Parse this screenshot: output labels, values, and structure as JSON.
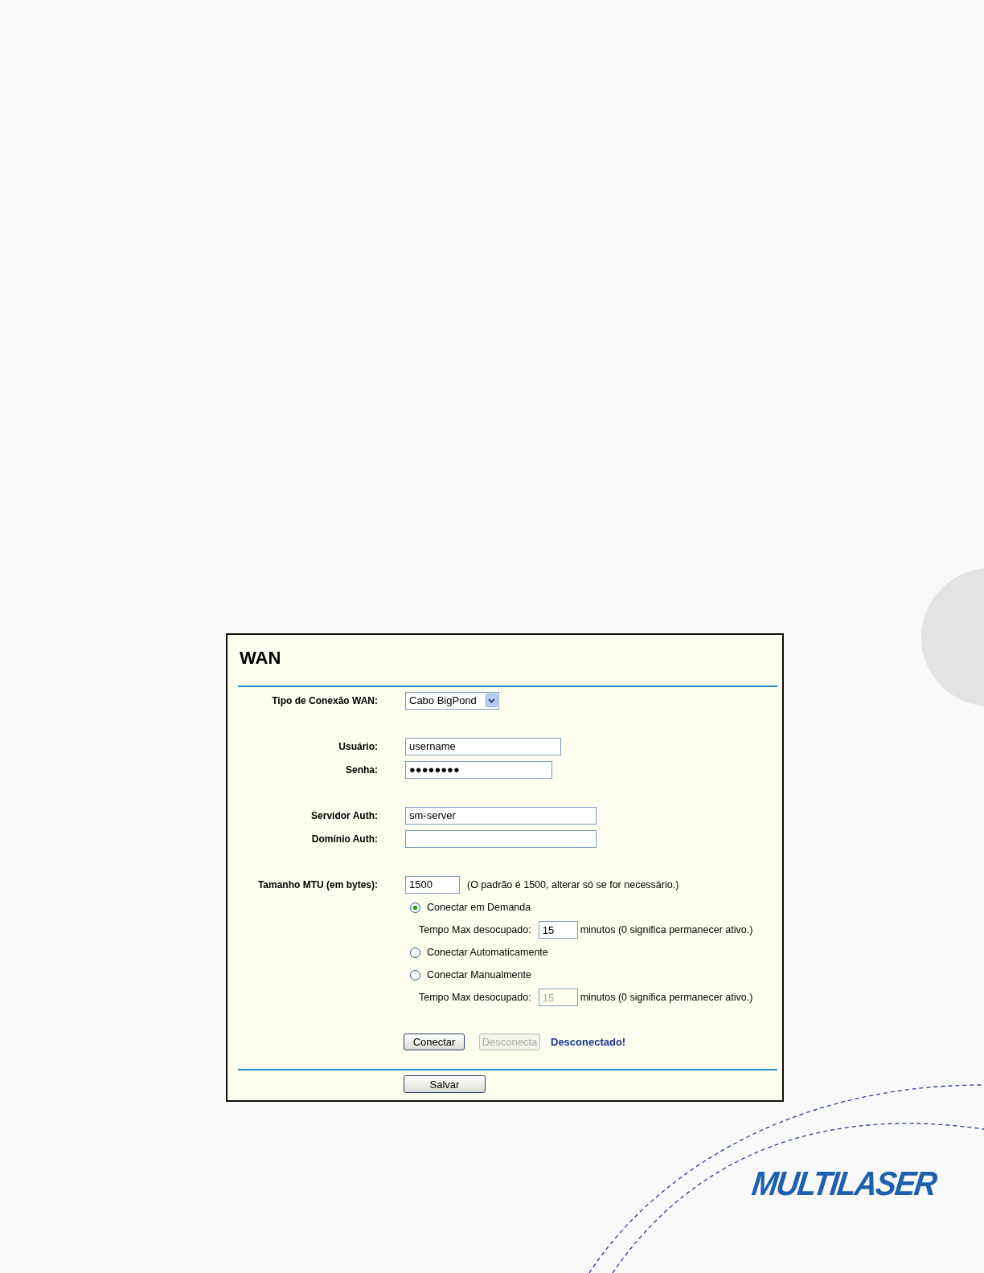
{
  "panel": {
    "title": "WAN",
    "groups": [
      [
        {
          "kind": "select",
          "label": "Tipo de Conexão WAN:",
          "value": "Cabo BigPond"
        }
      ],
      [
        {
          "kind": "text",
          "label": "Usuário:",
          "value": "username"
        },
        {
          "kind": "password",
          "label": "Senha:",
          "value": "●●●●●●●●"
        }
      ],
      [
        {
          "kind": "text",
          "label": "Servidor Auth:",
          "value": "sm-server"
        },
        {
          "kind": "text",
          "label": "Domínio Auth:"
        }
      ],
      [
        {
          "kind": "mtu",
          "label": "Tamanho MTU (em bytes):",
          "value": "1500",
          "hint": "(O padrão é 1500, alterar só se for necessário.)"
        }
      ]
    ],
    "connection_modes": [
      {
        "label": "Conectar em Demanda",
        "selected": true,
        "idle": {
          "label": "Tempo Max desocupado:",
          "value": "15",
          "suffix": "minutos (0 significa permanecer ativo.)",
          "disabled": false
        }
      },
      {
        "label": "Conectar Automaticamente",
        "selected": false
      },
      {
        "label": "Conectar Manualmente",
        "selected": false,
        "idle": {
          "label": "Tempo Max desocupado:",
          "value": "15",
          "suffix": "minutos (0 significa permanecer ativo.)",
          "disabled": true
        }
      }
    ],
    "buttons": [
      {
        "label": "Conectar",
        "disabled": false
      },
      {
        "label": "Desconecta",
        "disabled": true
      }
    ],
    "status": "Desconectado!",
    "save_button": "Salvar"
  },
  "logo": "MULTILASER"
}
